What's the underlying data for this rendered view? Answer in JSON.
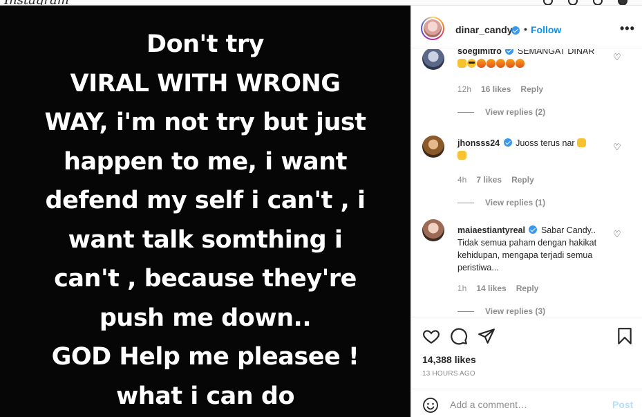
{
  "top_bar": {
    "logo_text": "Instagram"
  },
  "post": {
    "text_lines": [
      "Don't try",
      "VIRAL WITH WRONG",
      "WAY, i'm not try but just",
      "happen to me, i want",
      "defend my self i can't , i",
      "want talk somthing i",
      "can't , because they're",
      "push me down..",
      "GOD Help me pleasee !",
      "what i can do"
    ]
  },
  "header": {
    "username": "dinar_candy",
    "separator": "•",
    "follow_label": "Follow",
    "more_label": "•••"
  },
  "comments": [
    {
      "username": "soegimitro",
      "text": "SEMANGAT DINAR",
      "emojis": [
        "fist",
        "cool",
        "fire",
        "fire",
        "fire",
        "fire",
        "fire"
      ],
      "time": "12h",
      "likes": "16 likes",
      "reply_label": "Reply",
      "view_replies": "View replies (2)"
    },
    {
      "username": "jhonsss24",
      "text": "Juoss terus nar",
      "emojis": [
        "fist",
        "fist"
      ],
      "time": "4h",
      "likes": "7 likes",
      "reply_label": "Reply",
      "view_replies": "View replies (1)"
    },
    {
      "username": "maiaestiantyreal",
      "text": "Sabar Candy.. Tidak semua paham dengan hakikat kehidupan, mengapa terjadi semua peristiwa...",
      "time": "1h",
      "likes": "14 likes",
      "reply_label": "Reply",
      "view_replies": "View replies (3)"
    }
  ],
  "actions": {
    "likes": "14,388 likes",
    "timestamp": "13 HOURS AGO"
  },
  "add_comment": {
    "placeholder": "Add a comment…",
    "post_label": "Post"
  },
  "colors": {
    "follow": "#0095f6",
    "verified": "#3897f0",
    "muted": "#8e8e8e",
    "text": "#262626",
    "post_disabled": "#b2dffc"
  }
}
